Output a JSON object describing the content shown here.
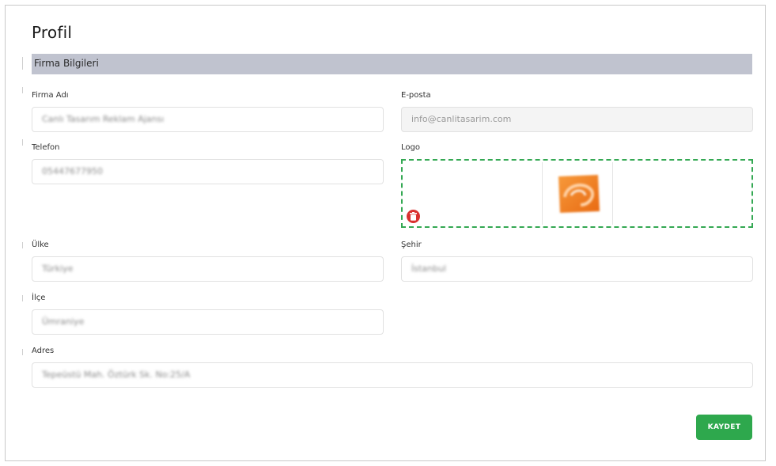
{
  "page": {
    "title": "Profil",
    "section_title": "Firma Bilgileri"
  },
  "fields": {
    "company_name": {
      "label": "Firma Adı",
      "value": "Canlı Tasarım Reklam Ajansı"
    },
    "email": {
      "label": "E-posta",
      "value": "info@canlitasarim.com"
    },
    "phone": {
      "label": "Telefon",
      "value": "05447677950"
    },
    "logo": {
      "label": "Logo"
    },
    "country": {
      "label": "Ülke",
      "value": "Türkiye"
    },
    "city": {
      "label": "Şehir",
      "value": "İstanbul"
    },
    "district": {
      "label": "İlçe",
      "value": "Ümraniye"
    },
    "address": {
      "label": "Adres",
      "value": "Tepeüstü Mah. Öztürk Sk. No:25/A"
    }
  },
  "actions": {
    "save_label": "KAYDET"
  },
  "icons": {
    "delete": "trash-icon",
    "logo": "company-logo-image"
  },
  "colors": {
    "section_bar": "#c0c3cf",
    "logo_border": "#34a853",
    "delete": "#d9312f",
    "save": "#2ea84d",
    "logo_orange": "#f07a1e"
  }
}
